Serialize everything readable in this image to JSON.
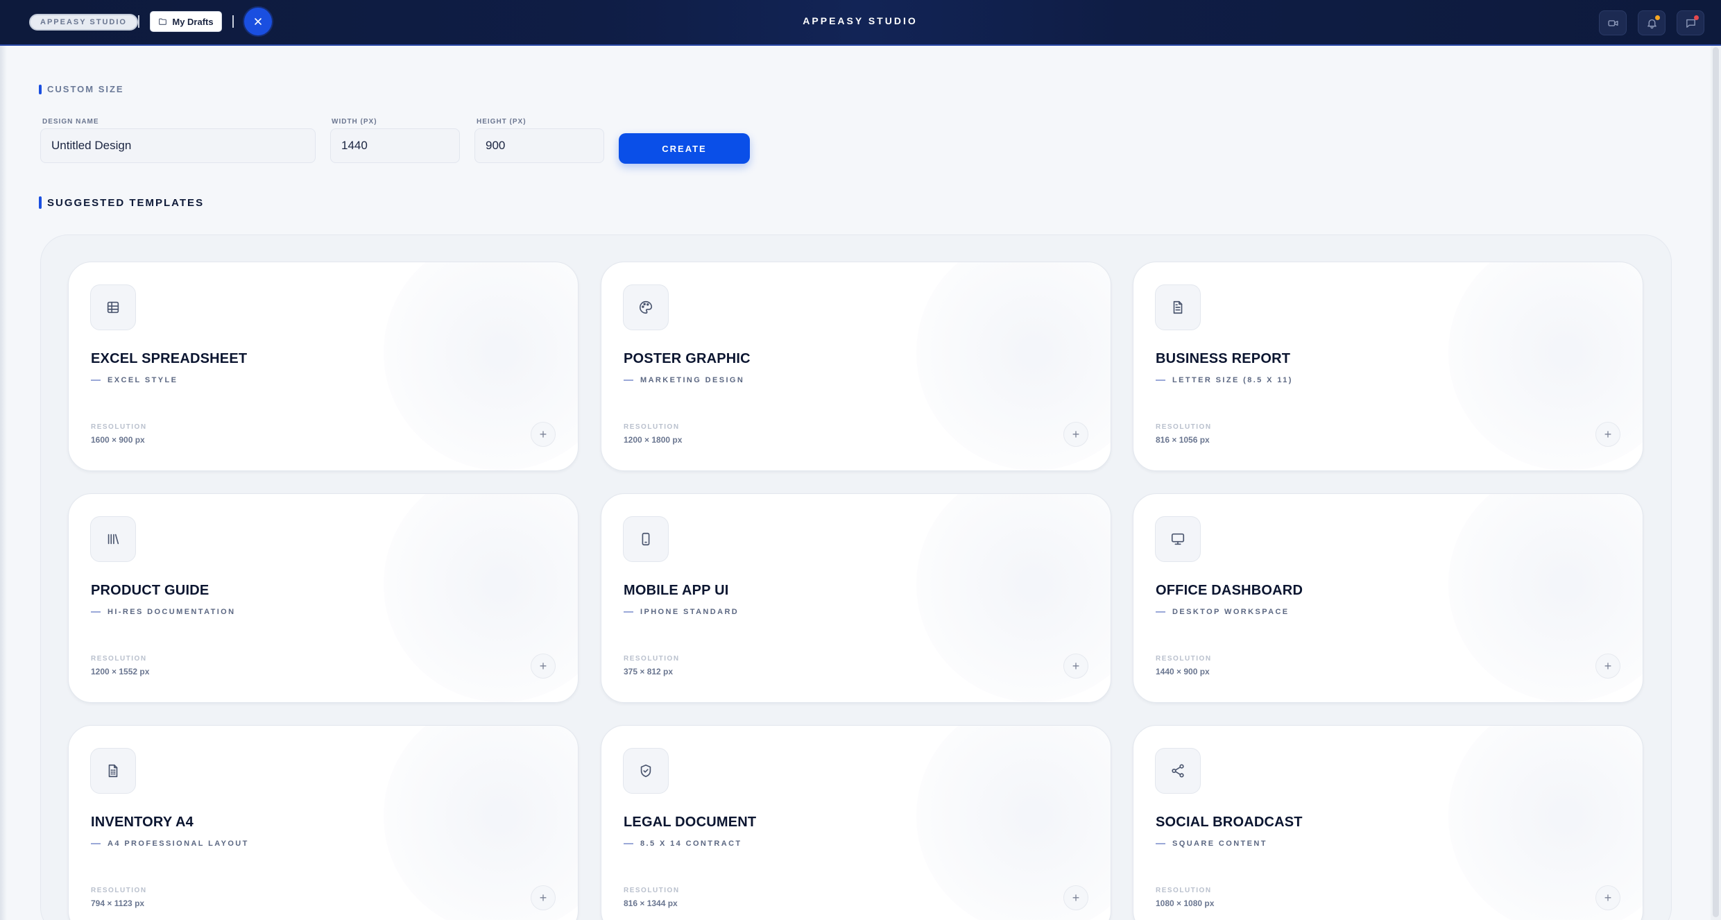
{
  "header": {
    "brand": "APPEASY STUDIO",
    "drafts_label": "My Drafts",
    "title": "APPEASY STUDIO",
    "icons": [
      "video-icon",
      "bell-icon",
      "chat-icon"
    ],
    "accent": "#1a4fe0",
    "notification_color": "#f5a623",
    "alert_color": "#e5484d"
  },
  "custom": {
    "section_label": "CUSTOM SIZE",
    "name_label": "DESIGN NAME",
    "name_value": "Untitled Design",
    "width_label": "WIDTH (PX)",
    "width_value": "1440",
    "height_label": "HEIGHT (PX)",
    "height_value": "900",
    "create_label": "CREATE"
  },
  "suggested": {
    "section_label": "SUGGESTED TEMPLATES",
    "resolution_label": "RESOLUTION",
    "templates": [
      {
        "title": "EXCEL SPREADSHEET",
        "subtitle": "EXCEL STYLE",
        "resolution": "1600 × 900 px",
        "icon": "table-icon"
      },
      {
        "title": "POSTER GRAPHIC",
        "subtitle": "MARKETING DESIGN",
        "resolution": "1200 × 1800 px",
        "icon": "palette-icon"
      },
      {
        "title": "BUSINESS REPORT",
        "subtitle": "LETTER SIZE (8.5 X 11)",
        "resolution": "816 × 1056 px",
        "icon": "document-icon"
      },
      {
        "title": "PRODUCT GUIDE",
        "subtitle": "HI-RES DOCUMENTATION",
        "resolution": "1200 × 1552 px",
        "icon": "library-icon"
      },
      {
        "title": "MOBILE APP UI",
        "subtitle": "IPHONE STANDARD",
        "resolution": "375 × 812 px",
        "icon": "smartphone-icon"
      },
      {
        "title": "OFFICE DASHBOARD",
        "subtitle": "DESKTOP WORKSPACE",
        "resolution": "1440 × 900 px",
        "icon": "monitor-icon"
      },
      {
        "title": "INVENTORY A4",
        "subtitle": "A4 PROFESSIONAL LAYOUT",
        "resolution": "794 × 1123 px",
        "icon": "spreadsheet-file-icon"
      },
      {
        "title": "LEGAL DOCUMENT",
        "subtitle": "8.5 X 14 CONTRACT",
        "resolution": "816 × 1344 px",
        "icon": "shield-check-icon"
      },
      {
        "title": "SOCIAL BROADCAST",
        "subtitle": "SQUARE CONTENT",
        "resolution": "1080 × 1080 px",
        "icon": "share-icon"
      }
    ]
  }
}
